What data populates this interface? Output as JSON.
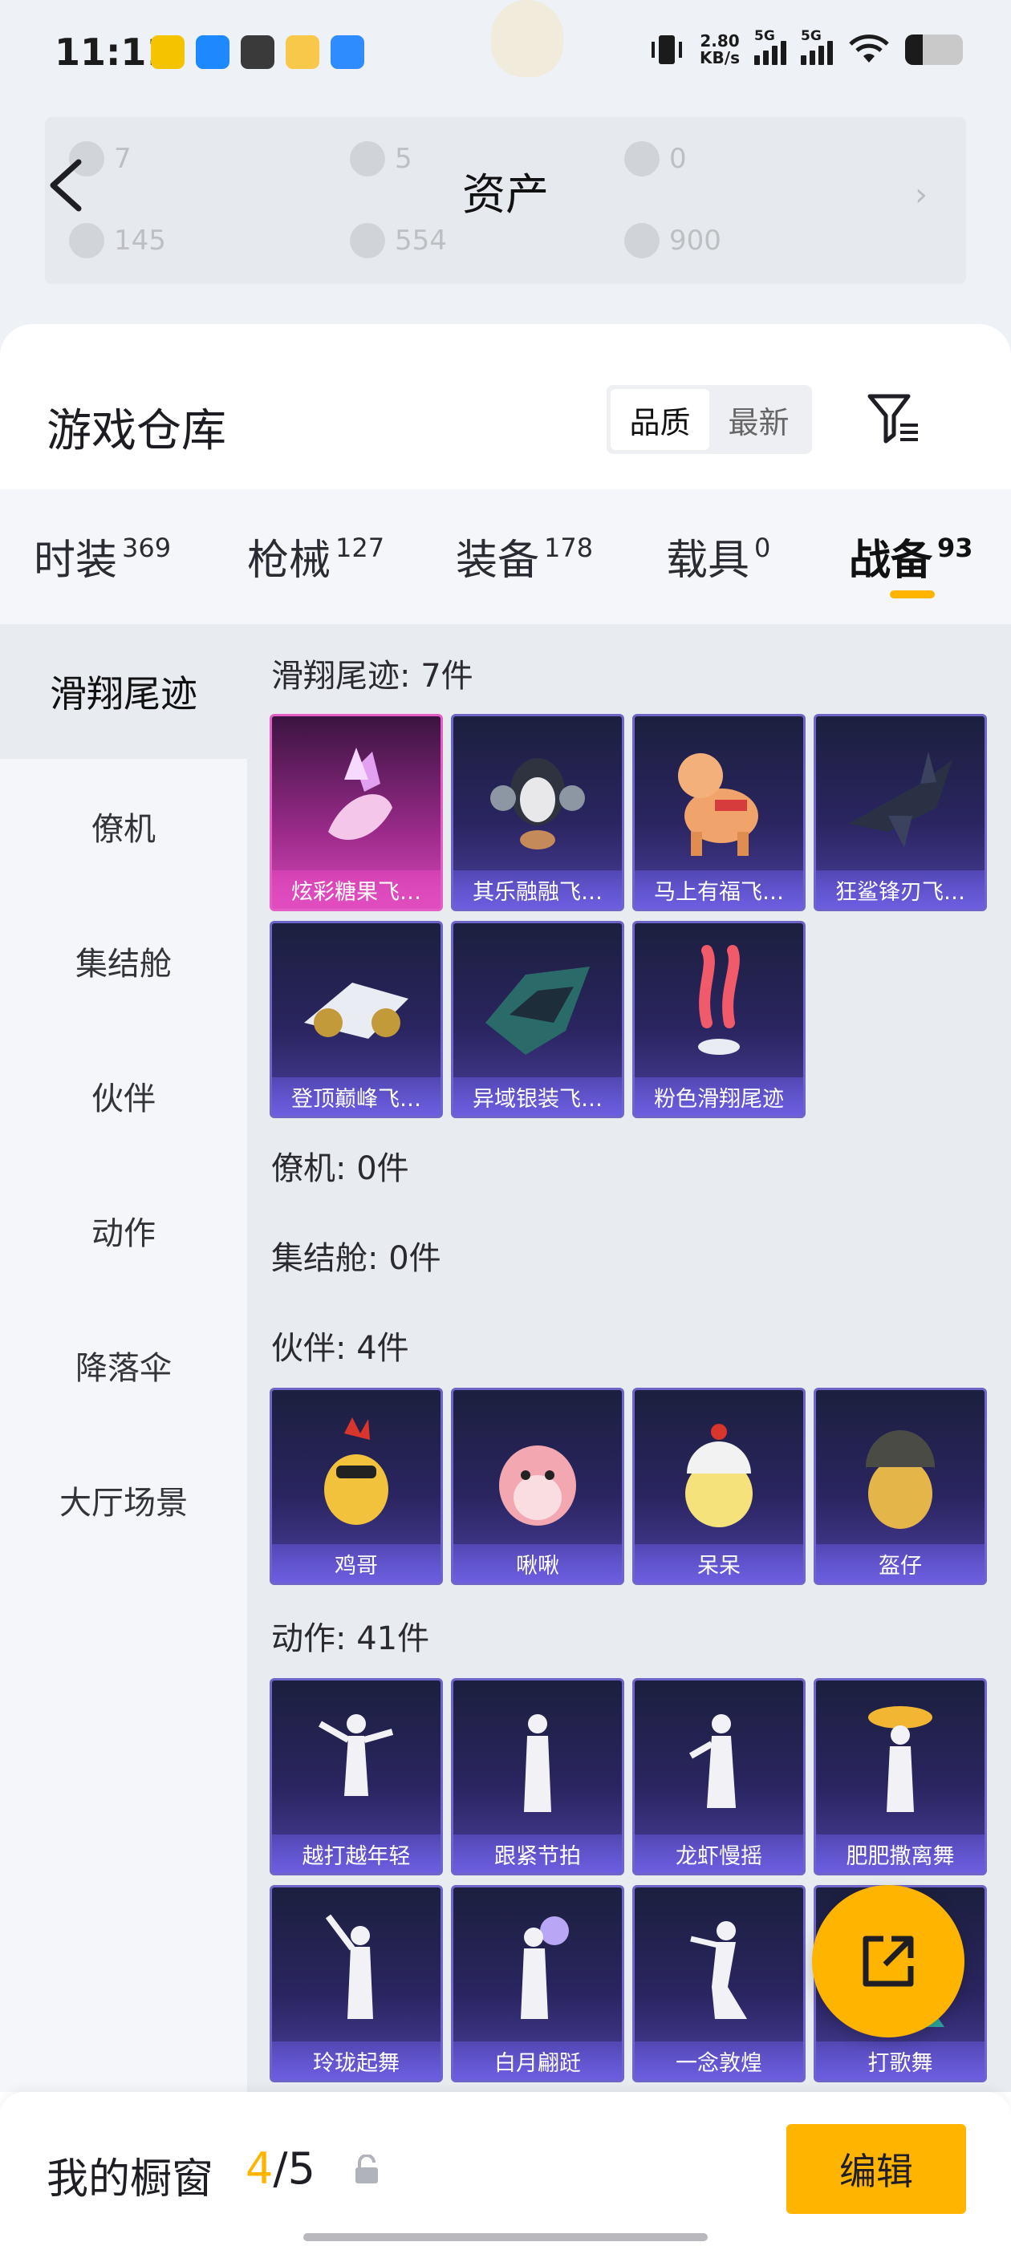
{
  "status_bar": {
    "time": "11:11",
    "net_speed_value": "2.80",
    "net_speed_unit": "KB/s",
    "sim1_label": "5G",
    "sim2_label": "5G",
    "battery_level": 0.3,
    "app_icon_colors": [
      "#f5c400",
      "#1e88ff",
      "#3a3a3a",
      "#f7c84a",
      "#2f8cff"
    ]
  },
  "asset_header": {
    "title": "资产",
    "values": [
      "7",
      "5",
      "0",
      "145",
      "554",
      "900"
    ]
  },
  "warehouse": {
    "title": "游戏仓库",
    "sort_options": [
      "品质",
      "最新"
    ],
    "active_sort": "品质"
  },
  "tabs": [
    {
      "label": "时装",
      "count": "369"
    },
    {
      "label": "枪械",
      "count": "127"
    },
    {
      "label": "装备",
      "count": "178"
    },
    {
      "label": "载具",
      "count": "0"
    },
    {
      "label": "战备",
      "count": "93"
    }
  ],
  "sidebar": {
    "items": [
      "滑翔尾迹",
      "僚机",
      "集结舱",
      "伙伴",
      "动作",
      "降落伞",
      "大厅场景"
    ],
    "active": "滑翔尾迹"
  },
  "groups": {
    "trail": {
      "title": "滑翔尾迹: 7件",
      "items": [
        "炫彩糖果飞…",
        "其乐融融飞…",
        "马上有福飞…",
        "狂鲨锋刃飞…",
        "登顶巅峰飞…",
        "异域银装飞…",
        "粉色滑翔尾迹"
      ]
    },
    "wingman": {
      "title": "僚机: 0件"
    },
    "capsule": {
      "title": "集结舱: 0件"
    },
    "partner": {
      "title": "伙伴: 4件",
      "items": [
        "鸡哥",
        "啾啾",
        "呆呆",
        "盔仔"
      ]
    },
    "emote": {
      "title": "动作: 41件",
      "items": [
        "越打越年轻",
        "跟紧节拍",
        "龙虾慢摇",
        "肥肥撒离舞",
        "玲珑起舞",
        "白月翩跹",
        "一念敦煌",
        "打歌舞"
      ]
    }
  },
  "bottom_bar": {
    "label": "我的橱窗",
    "current": "4",
    "separator": "/",
    "total": "5",
    "edit_label": "编辑"
  },
  "colors": {
    "accent": "#ffb400",
    "card_purple": "#6c5ee0",
    "card_pink": "#e04dbf"
  }
}
